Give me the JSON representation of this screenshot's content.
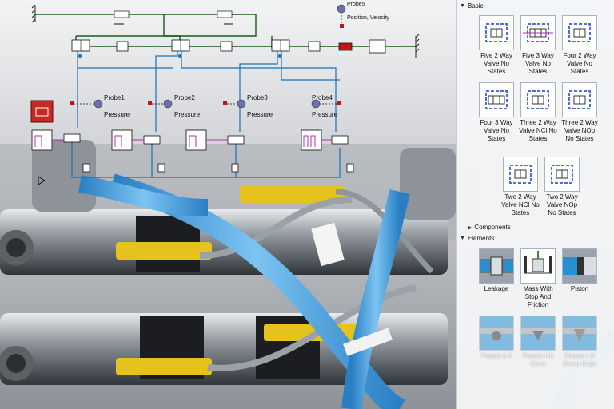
{
  "schematic": {
    "probes": [
      {
        "name": "Probe1",
        "kind": "Pressure"
      },
      {
        "name": "Probe2",
        "kind": "Pressure"
      },
      {
        "name": "Probe3",
        "kind": "Pressure"
      },
      {
        "name": "Probe4",
        "kind": "Pressure"
      }
    ],
    "top_probe": {
      "name": "Probe5",
      "kind": "Position, Velocity"
    }
  },
  "library": {
    "basic": {
      "label": "Basic",
      "items": [
        {
          "label": "Five  2 Way Valve No States"
        },
        {
          "label": "Five  3 Way Valve No States"
        },
        {
          "label": "Four  2 Way Valve No States"
        },
        {
          "label": "Four  3 Way Valve No States"
        },
        {
          "label": "Three  2 Way Valve NCl No States"
        },
        {
          "label": "Three  2 Way Valve NOp No States"
        },
        {
          "label": "Two  2 Way Valve NCl No States"
        },
        {
          "label": "Two  2 Way Valve NOp No States"
        }
      ]
    },
    "components": {
      "label": "Components"
    },
    "elements": {
      "label": "Elements",
      "items": [
        {
          "label": "Leakage"
        },
        {
          "label": "Mass With Stop And Friction"
        },
        {
          "label": "Piston"
        },
        {
          "label": "Poppet Lift"
        },
        {
          "label": "Poppet Lift Cone"
        },
        {
          "label": "Poppet Lift Sharp Edge"
        }
      ]
    }
  }
}
